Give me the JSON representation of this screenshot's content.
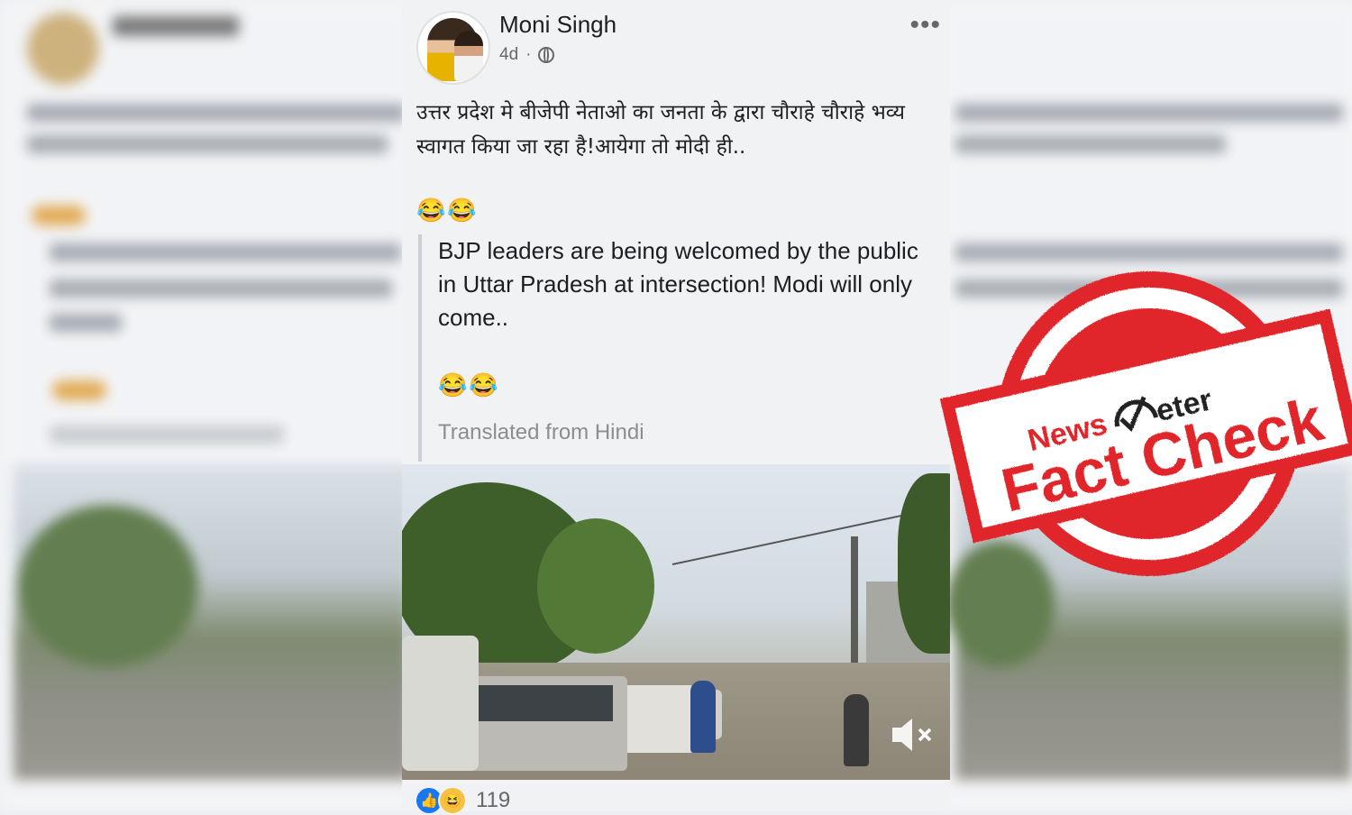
{
  "post": {
    "author": "Moni Singh",
    "time": "4d",
    "separator": "·",
    "more": "•••",
    "text_hindi": "उत्तर प्रदेश मे बीजेपी नेताओ का जनता के द्वारा चौराहे चौराहे भव्य स्वागत किया जा रहा है!आयेगा तो मोदी ही..",
    "emoji_1": "😂😂",
    "translation": "BJP leaders are being welcomed by the public in Uttar Pradesh at intersection! Modi will only come..",
    "emoji_2": "😂😂",
    "translated_note": "Translated from Hindi",
    "reaction_count": "119",
    "icons": [
      "globe-icon",
      "more-icon",
      "mute-icon",
      "like-icon",
      "haha-icon"
    ]
  },
  "stamp": {
    "brand_news": "News",
    "brand_meter": "eter",
    "label": "Fact Check",
    "color": "#e0262b"
  }
}
